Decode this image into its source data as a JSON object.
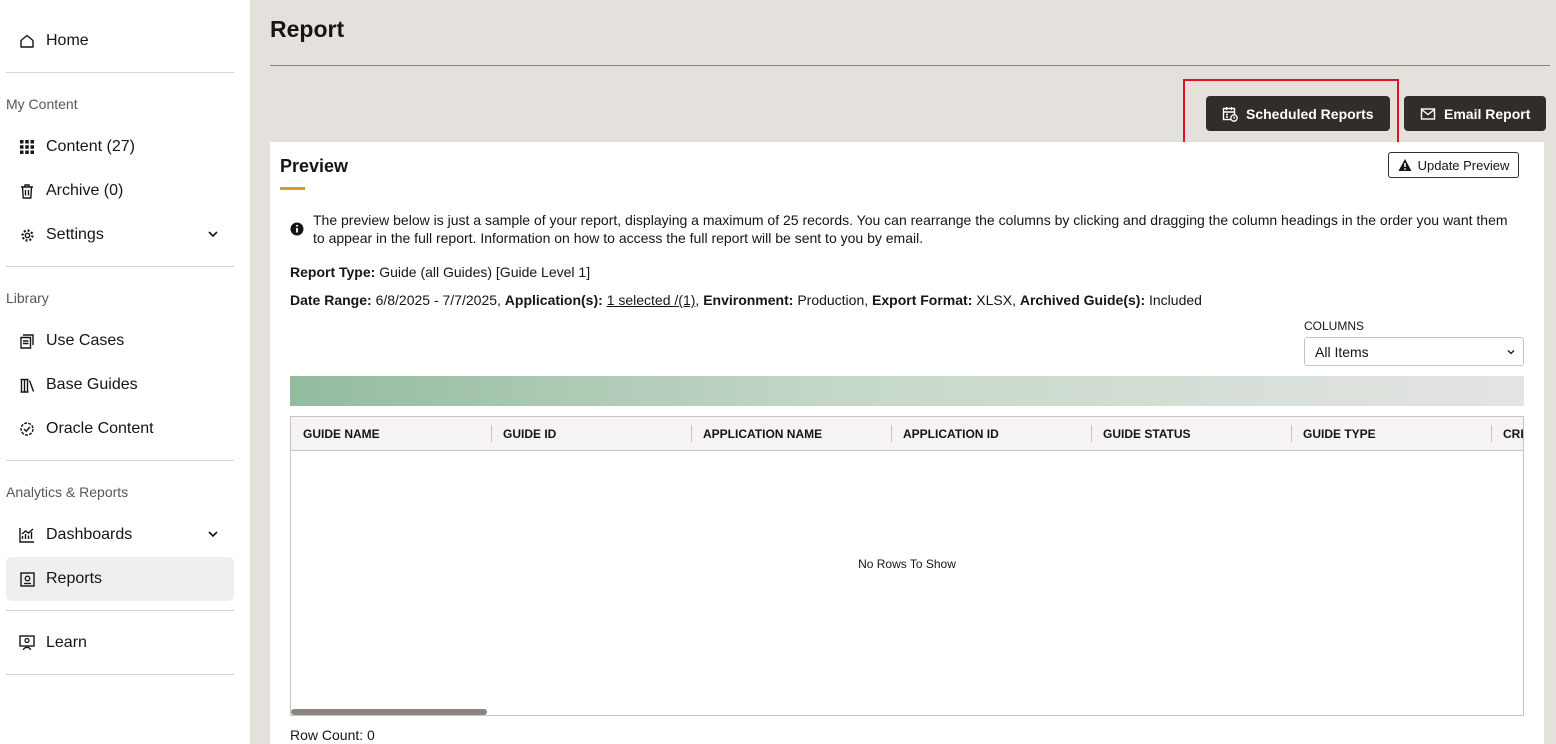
{
  "sidebar": {
    "home": "Home",
    "my_content_label": "My Content",
    "content": "Content (27)",
    "archive": "Archive (0)",
    "settings": "Settings",
    "library_label": "Library",
    "use_cases": "Use Cases",
    "base_guides": "Base Guides",
    "oracle_content": "Oracle Content",
    "analytics_label": "Analytics & Reports",
    "dashboards": "Dashboards",
    "reports": "Reports",
    "learn": "Learn"
  },
  "header": {
    "title": "Report",
    "scheduled_reports": "Scheduled Reports",
    "email_report": "Email Report"
  },
  "preview": {
    "title": "Preview",
    "update_button": "Update Preview",
    "info_text": "The preview below is just a sample of your report, displaying a maximum of 25 records. You can rearrange the columns by clicking and dragging the column headings in the order you want them to appear in the full report. Information on how to access the full report will be sent to you by email.",
    "report_type_label": "Report Type:",
    "report_type_value": "Guide (all Guides) [Guide Level 1]",
    "date_range_label": "Date Range:",
    "date_range_value": "6/8/2025 - 7/7/2025,",
    "application_label": "Application(s):",
    "application_value": "1 selected  /(1)",
    "application_suffix": ",",
    "environment_label": "Environment:",
    "environment_value": "Production,",
    "export_label": "Export Format:",
    "export_value": "XLSX,",
    "archived_label": "Archived Guide(s):",
    "archived_value": "Included",
    "columns_label": "COLUMNS",
    "columns_selected": "All Items",
    "grid_columns": [
      "GUIDE NAME",
      "GUIDE ID",
      "APPLICATION NAME",
      "APPLICATION ID",
      "GUIDE STATUS",
      "GUIDE TYPE",
      "CRE"
    ],
    "empty_message": "No Rows To Show",
    "row_count": "Row Count: 0"
  },
  "colors": {
    "dark_button": "#312d2a",
    "highlight": "#e0141e",
    "accent_underline": "#d99a2c",
    "background": "#e4e1dd"
  }
}
